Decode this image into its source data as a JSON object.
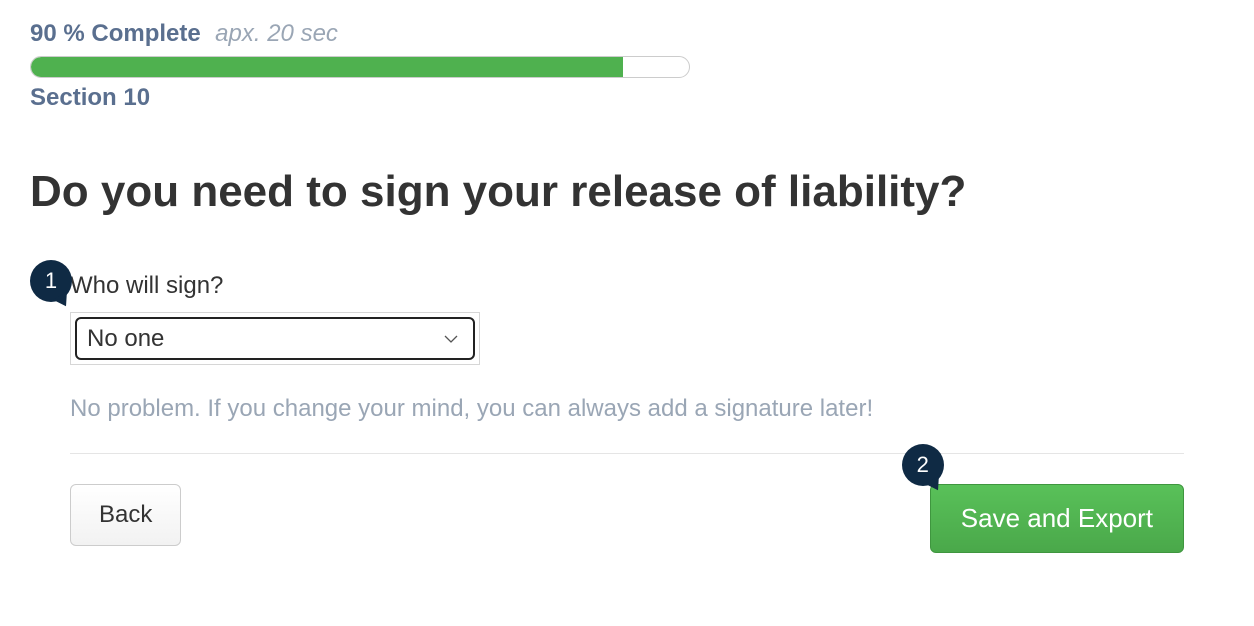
{
  "progress": {
    "percent_label": "90 % Complete",
    "time_label": "apx. 20 sec",
    "percent_value": 90,
    "section_label": "Section 10"
  },
  "question": {
    "title": "Do you need to sign your release of liability?",
    "field_label": "Who will sign?",
    "selected_value": "No one",
    "hint": "No problem. If you change your mind, you can always add a signature later!"
  },
  "buttons": {
    "back_label": "Back",
    "save_label": "Save and Export"
  },
  "callouts": {
    "step1": "1",
    "step2": "2"
  }
}
